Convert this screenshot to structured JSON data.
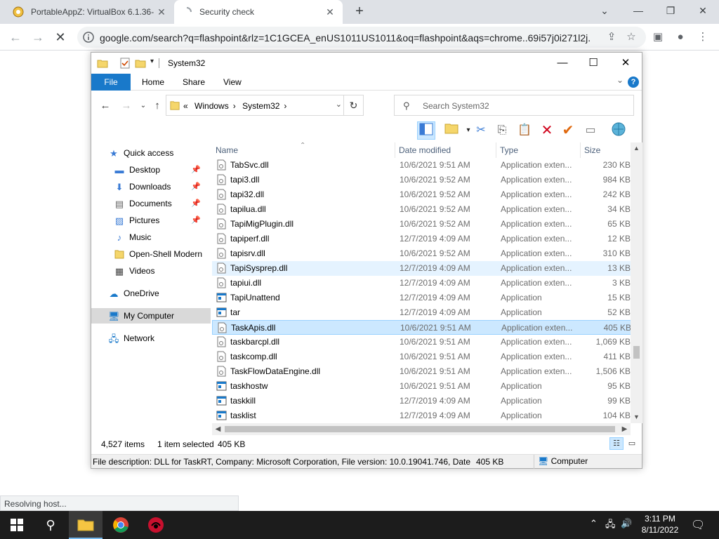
{
  "browser": {
    "tabs": [
      {
        "title": "PortableAppZ: VirtualBox 6.1.36-",
        "active": false
      },
      {
        "title": "Security check",
        "active": true
      }
    ],
    "url": "google.com/search?q=flashpoint&rlz=1C1GCEA_enUS1011US1011&oq=flashpoint&aqs=chrome..69i57j0i271l2j...",
    "status_text": "Resolving host..."
  },
  "explorer": {
    "title": "System32",
    "ribbon_tabs": [
      "File",
      "Home",
      "Share",
      "View"
    ],
    "breadcrumb_overflow": "«",
    "breadcrumb": [
      "Windows",
      "System32"
    ],
    "search_placeholder": "Search System32",
    "nav": [
      {
        "label": "Quick access",
        "icon": "star-icon",
        "pinned": false
      },
      {
        "label": "Desktop",
        "icon": "desktop-icon",
        "pinned": true
      },
      {
        "label": "Downloads",
        "icon": "downloads-icon",
        "pinned": true
      },
      {
        "label": "Documents",
        "icon": "documents-icon",
        "pinned": true
      },
      {
        "label": "Pictures",
        "icon": "pictures-icon",
        "pinned": true
      },
      {
        "label": "Music",
        "icon": "music-icon",
        "pinned": false
      },
      {
        "label": "Open-Shell Modern",
        "icon": "folder-icon",
        "pinned": false
      },
      {
        "label": "Videos",
        "icon": "videos-icon",
        "pinned": false
      },
      {
        "label": "OneDrive",
        "icon": "cloud-icon",
        "pinned": false
      },
      {
        "label": "My Computer",
        "icon": "computer-icon",
        "pinned": false,
        "selected": true
      },
      {
        "label": "Network",
        "icon": "network-icon",
        "pinned": false
      }
    ],
    "columns": {
      "name": "Name",
      "date": "Date modified",
      "type": "Type",
      "size": "Size"
    },
    "files": [
      {
        "name": "TabSvc.dll",
        "date": "10/6/2021 9:51 AM",
        "type": "Application exten...",
        "size": "230 KB",
        "kind": "dll"
      },
      {
        "name": "tapi3.dll",
        "date": "10/6/2021 9:52 AM",
        "type": "Application exten...",
        "size": "984 KB",
        "kind": "dll"
      },
      {
        "name": "tapi32.dll",
        "date": "10/6/2021 9:52 AM",
        "type": "Application exten...",
        "size": "242 KB",
        "kind": "dll"
      },
      {
        "name": "tapilua.dll",
        "date": "10/6/2021 9:52 AM",
        "type": "Application exten...",
        "size": "34 KB",
        "kind": "dll"
      },
      {
        "name": "TapiMigPlugin.dll",
        "date": "10/6/2021 9:52 AM",
        "type": "Application exten...",
        "size": "65 KB",
        "kind": "dll"
      },
      {
        "name": "tapiperf.dll",
        "date": "12/7/2019 4:09 AM",
        "type": "Application exten...",
        "size": "12 KB",
        "kind": "dll"
      },
      {
        "name": "tapisrv.dll",
        "date": "10/6/2021 9:52 AM",
        "type": "Application exten...",
        "size": "310 KB",
        "kind": "dll"
      },
      {
        "name": "TapiSysprep.dll",
        "date": "12/7/2019 4:09 AM",
        "type": "Application exten...",
        "size": "13 KB",
        "kind": "dll",
        "hover": true
      },
      {
        "name": "tapiui.dll",
        "date": "12/7/2019 4:09 AM",
        "type": "Application exten...",
        "size": "3 KB",
        "kind": "dll"
      },
      {
        "name": "TapiUnattend",
        "date": "12/7/2019 4:09 AM",
        "type": "Application",
        "size": "15 KB",
        "kind": "exe"
      },
      {
        "name": "tar",
        "date": "12/7/2019 4:09 AM",
        "type": "Application",
        "size": "52 KB",
        "kind": "exe"
      },
      {
        "name": "TaskApis.dll",
        "date": "10/6/2021 9:51 AM",
        "type": "Application exten...",
        "size": "405 KB",
        "kind": "dll",
        "selected": true
      },
      {
        "name": "taskbarcpl.dll",
        "date": "10/6/2021 9:51 AM",
        "type": "Application exten...",
        "size": "1,069 KB",
        "kind": "dll"
      },
      {
        "name": "taskcomp.dll",
        "date": "10/6/2021 9:51 AM",
        "type": "Application exten...",
        "size": "411 KB",
        "kind": "dll"
      },
      {
        "name": "TaskFlowDataEngine.dll",
        "date": "10/6/2021 9:51 AM",
        "type": "Application exten...",
        "size": "1,506 KB",
        "kind": "dll"
      },
      {
        "name": "taskhostw",
        "date": "10/6/2021 9:51 AM",
        "type": "Application",
        "size": "95 KB",
        "kind": "exe"
      },
      {
        "name": "taskkill",
        "date": "12/7/2019 4:09 AM",
        "type": "Application",
        "size": "99 KB",
        "kind": "exe"
      },
      {
        "name": "tasklist",
        "date": "12/7/2019 4:09 AM",
        "type": "Application",
        "size": "104 KB",
        "kind": "exe"
      }
    ],
    "status": {
      "items": "4,527 items",
      "selected": "1 item selected",
      "selected_size": "405 KB"
    },
    "details": {
      "description": "File description: DLL for TaskRT, Company: Microsoft Corporation, File version: 10.0.19041.746, Date crea",
      "size": "405 KB",
      "location": "Computer"
    }
  },
  "taskbar": {
    "time": "3:11 PM",
    "date": "8/11/2022",
    "accent": "#76b9ed"
  }
}
